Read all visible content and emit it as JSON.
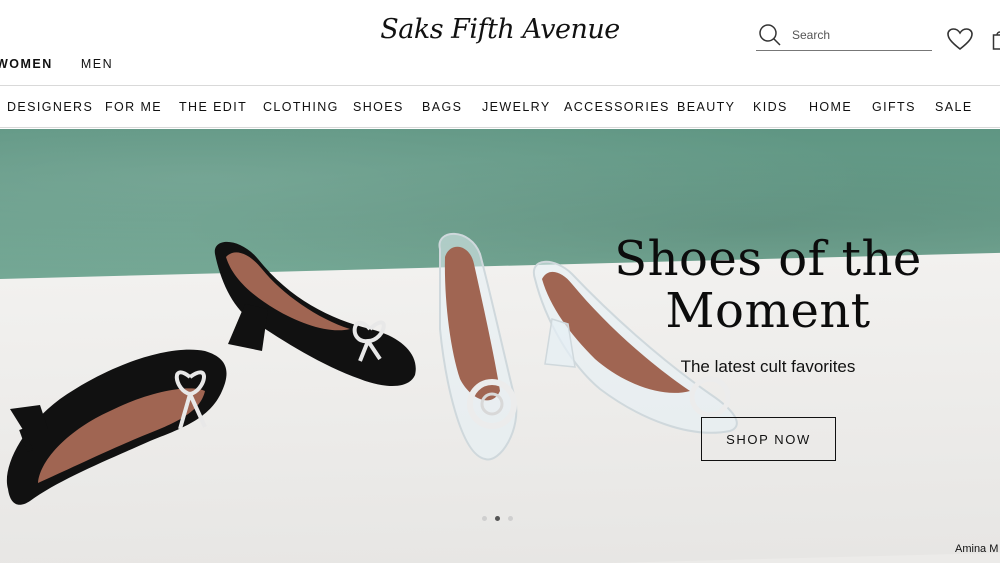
{
  "header": {
    "logo": "Saks Fifth Avenue",
    "gender_tabs": [
      {
        "label": "WOMEN",
        "active": true
      },
      {
        "label": "MEN",
        "active": false
      }
    ],
    "search": {
      "placeholder": "Search",
      "icon": "search-icon"
    },
    "icons": [
      "heart-icon",
      "shopping-bag-icon"
    ]
  },
  "nav": {
    "items": [
      "DESIGNERS",
      "FOR ME",
      "THE EDIT",
      "CLOTHING",
      "SHOES",
      "BAGS",
      "JEWELRY",
      "ACCESSORIES",
      "BEAUTY",
      "KIDS",
      "HOME",
      "GIFTS",
      "SALE"
    ]
  },
  "hero": {
    "title_line1": "Shoes of the",
    "title_line2": "Moment",
    "subtitle": "The latest cult favorites",
    "cta": "SHOP NOW",
    "caption": "Amina M",
    "carousel": {
      "count": 3,
      "active_index": 1
    },
    "colors": {
      "wall": "#6a9f8c",
      "floor": "#ecebe9",
      "shoe_black": "#111111",
      "shoe_lining": "#a06552"
    }
  }
}
